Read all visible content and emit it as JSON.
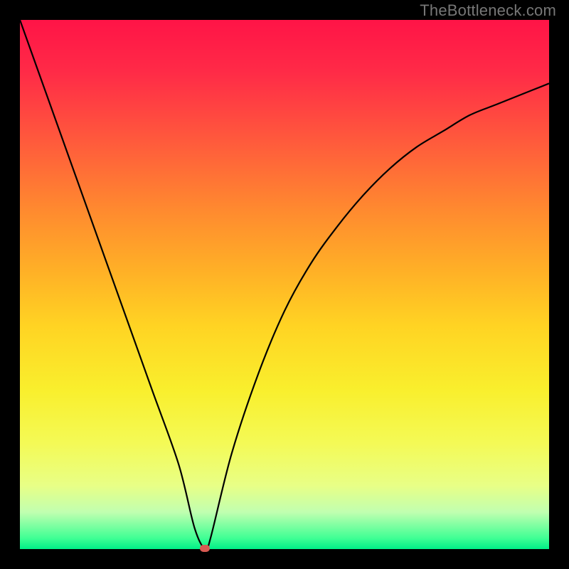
{
  "watermark": "TheBottleneck.com",
  "chart_data": {
    "type": "line",
    "title": "",
    "xlabel": "",
    "ylabel": "",
    "xlim": [
      0,
      100
    ],
    "ylim": [
      0,
      100
    ],
    "grid": false,
    "legend": false,
    "background_gradient": {
      "direction": "vertical",
      "stops": [
        {
          "pos": 0.0,
          "color": "#ff1447"
        },
        {
          "pos": 0.5,
          "color": "#ffc224"
        },
        {
          "pos": 0.8,
          "color": "#f4fa56"
        },
        {
          "pos": 1.0,
          "color": "#00ef87"
        }
      ]
    },
    "series": [
      {
        "name": "bottleneck-curve",
        "color": "#000000",
        "x": [
          0,
          5,
          10,
          15,
          20,
          25,
          30,
          33,
          35,
          36,
          40,
          45,
          50,
          55,
          60,
          65,
          70,
          75,
          80,
          85,
          90,
          95,
          100
        ],
        "y": [
          100,
          86,
          72,
          58,
          44,
          30,
          16,
          4,
          0,
          2,
          18,
          33,
          45,
          54,
          61,
          67,
          72,
          76,
          79,
          82,
          84,
          86,
          88
        ]
      }
    ],
    "marker": {
      "name": "optimal-point",
      "x": 35,
      "y": 0,
      "color": "#d85a52",
      "shape": "pill"
    },
    "annotations": []
  }
}
